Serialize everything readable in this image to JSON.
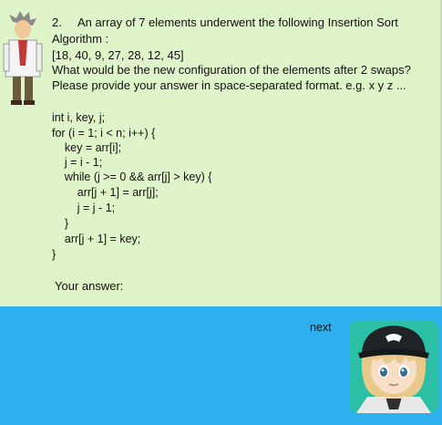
{
  "question": {
    "number": "2.",
    "lines": [
      "An array of 7 elements underwent the following Insertion Sort",
      "Algorithm :",
      "[18, 40, 9, 27, 28, 12, 45]",
      "What would be the new configuration of the elements after 2 swaps?",
      "Please provide your answer in space-separated format. e.g. x y z ..."
    ]
  },
  "code": [
    "int i, key, j;",
    "for (i = 1; i < n; i++) {",
    "    key = arr[i];",
    "    j = i - 1;",
    "    while (j >= 0 && arr[j] > key) {",
    "        arr[j + 1] = arr[j];",
    "        j = j - 1;",
    "    }",
    "    arr[j + 1] = key;",
    "}"
  ],
  "answer_label": "Your answer:",
  "next_label": "next",
  "colors": {
    "question_bg": "#dff5c9",
    "answer_bg": "#2eaff0"
  }
}
